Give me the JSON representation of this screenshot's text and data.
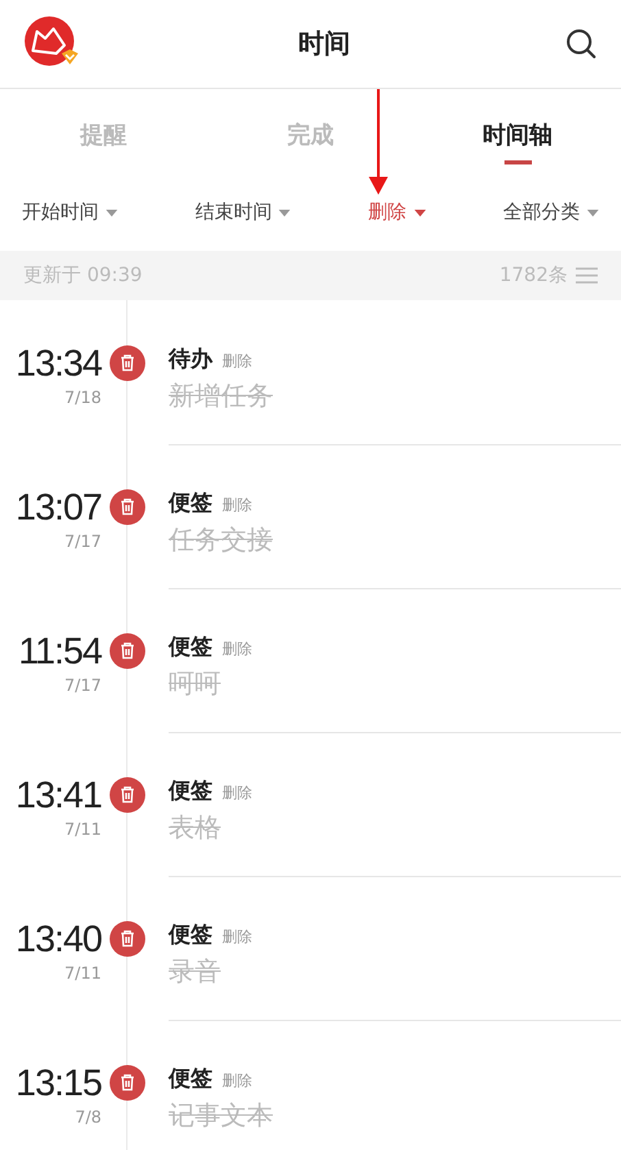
{
  "header": {
    "title": "时间"
  },
  "tabs": [
    {
      "label": "提醒",
      "selected": false
    },
    {
      "label": "完成",
      "selected": false
    },
    {
      "label": "时间轴",
      "selected": true
    }
  ],
  "filters": [
    {
      "label": "开始时间",
      "selected": false
    },
    {
      "label": "结束时间",
      "selected": false
    },
    {
      "label": "删除",
      "selected": true
    },
    {
      "label": "全部分类",
      "selected": false
    }
  ],
  "status_bar": {
    "updated": "更新于 09:39",
    "count": "1782条"
  },
  "entries": [
    {
      "time": "13:34",
      "date": "7/18",
      "category": "待办",
      "status": "删除",
      "text": "新增任务",
      "deleted": true
    },
    {
      "time": "13:07",
      "date": "7/17",
      "category": "便签",
      "status": "删除",
      "text": "任务交接",
      "deleted": true
    },
    {
      "time": "11:54",
      "date": "7/17",
      "category": "便签",
      "status": "删除",
      "text": "呵呵",
      "deleted": true
    },
    {
      "time": "13:41",
      "date": "7/11",
      "category": "便签",
      "status": "删除",
      "text": "表格",
      "deleted": true
    },
    {
      "time": "13:40",
      "date": "7/11",
      "category": "便签",
      "status": "删除",
      "text": "录音",
      "deleted": true
    },
    {
      "time": "13:15",
      "date": "7/8",
      "category": "便签",
      "status": "删除",
      "text": "记事文本",
      "deleted": true
    }
  ]
}
